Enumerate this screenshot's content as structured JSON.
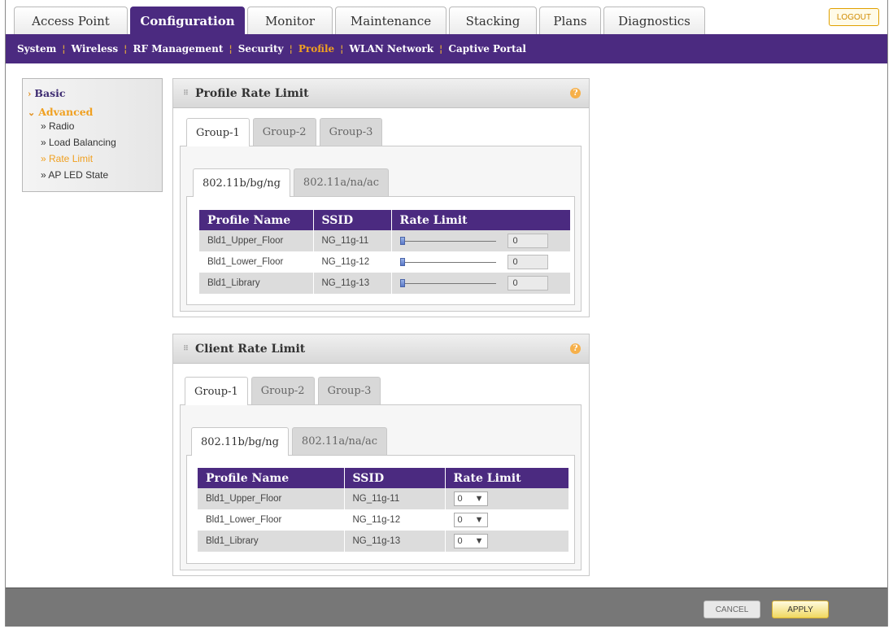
{
  "top_tabs": [
    "Access Point",
    "Configuration",
    "Monitor",
    "Maintenance",
    "Stacking",
    "Plans",
    "Diagnostics"
  ],
  "active_top_tab": "Configuration",
  "logout_label": "LOGOUT",
  "sub_nav": [
    "System",
    "Wireless",
    "RF Management",
    "Security",
    "Profile",
    "WLAN Network",
    "Captive Portal"
  ],
  "active_sub_nav": "Profile",
  "left_menu": {
    "basic": "Basic",
    "advanced": "Advanced",
    "items": [
      "» Radio",
      "» Load Balancing",
      "» Rate Limit",
      "» AP LED State"
    ],
    "active_item": "» Rate Limit"
  },
  "profile_panel": {
    "title": "Profile Rate Limit",
    "group_tabs": [
      "Group-1",
      "Group-2",
      "Group-3"
    ],
    "band_tabs": [
      "802.11b/bg/ng",
      "802.11a/na/ac"
    ],
    "columns": [
      "Profile Name",
      "SSID",
      "Rate Limit"
    ],
    "rows": [
      {
        "name": "Bld1_Upper_Floor",
        "ssid": "NG_11g-11",
        "value": "0",
        "level": 0
      },
      {
        "name": "Bld1_Lower_Floor",
        "ssid": "NG_11g-12",
        "value": "0",
        "level": 0
      },
      {
        "name": "Bld1_Library",
        "ssid": "NG_11g-13",
        "value": "0",
        "level": 0
      }
    ]
  },
  "client_panel": {
    "title": "Client Rate Limit",
    "group_tabs": [
      "Group-1",
      "Group-2",
      "Group-3"
    ],
    "band_tabs": [
      "802.11b/bg/ng",
      "802.11a/na/ac"
    ],
    "columns": [
      "Profile Name",
      "SSID",
      "Rate Limit"
    ],
    "rows": [
      {
        "name": "Bld1_Upper_Floor",
        "ssid": "NG_11g-11",
        "value": "0"
      },
      {
        "name": "Bld1_Lower_Floor",
        "ssid": "NG_11g-12",
        "value": "0"
      },
      {
        "name": "Bld1_Library",
        "ssid": "NG_11g-13",
        "value": "0"
      }
    ]
  },
  "footer": {
    "cancel": "CANCEL",
    "apply": "APPLY"
  },
  "colors": {
    "brand_purple": "#4b2a80",
    "accent_orange": "#f0a020"
  },
  "icons": {
    "help": "help-icon",
    "arrow": "chevron-right-icon",
    "dropdown": "caret-down-icon"
  }
}
